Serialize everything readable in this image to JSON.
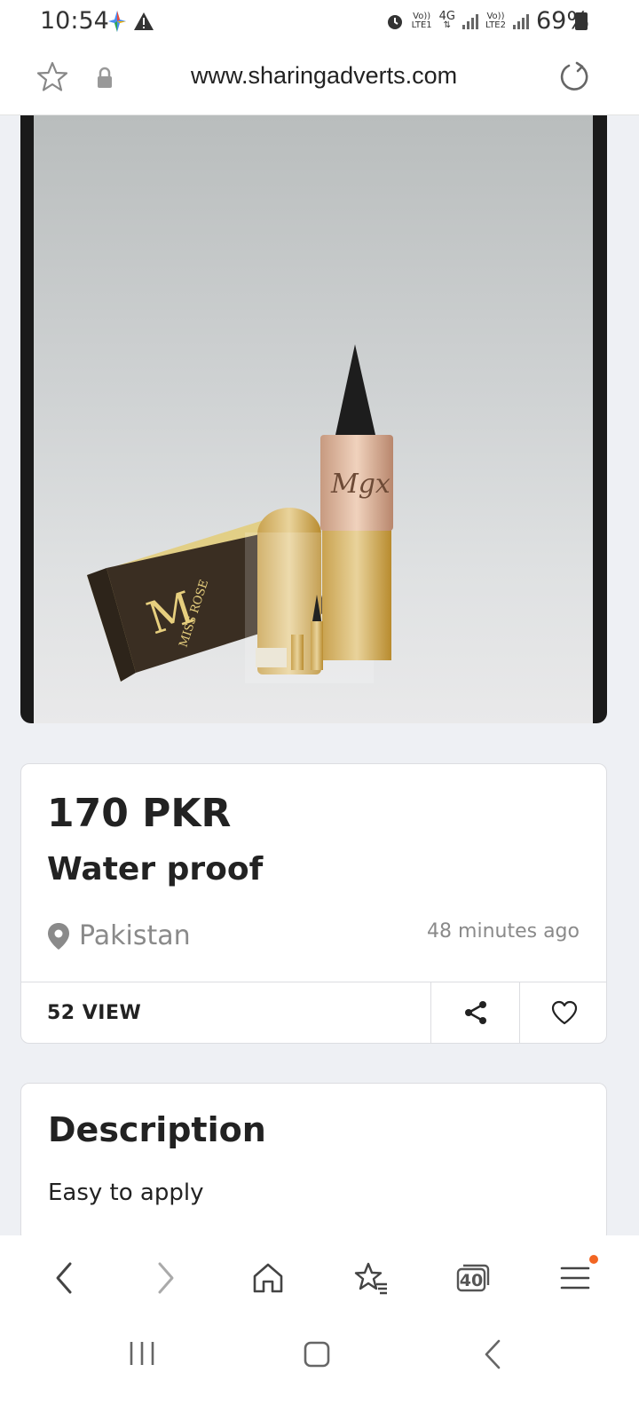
{
  "status": {
    "time": "10:54",
    "battery": "69%",
    "net1_top": "Vo))",
    "net1_bottom": "LTE1",
    "net_4g": "4G",
    "net2_top": "Vo))",
    "net2_bottom": "LTE2"
  },
  "browser": {
    "url": "www.sharingadverts.com",
    "tab_count": "40"
  },
  "listing": {
    "price": "170 PKR",
    "title": "Water proof",
    "location": "Pakistan",
    "posted": "48 minutes ago",
    "views": "52 VIEW"
  },
  "description": {
    "heading": "Description",
    "text": "Easy to apply"
  },
  "colors": {
    "accent_dot": "#f26522"
  }
}
